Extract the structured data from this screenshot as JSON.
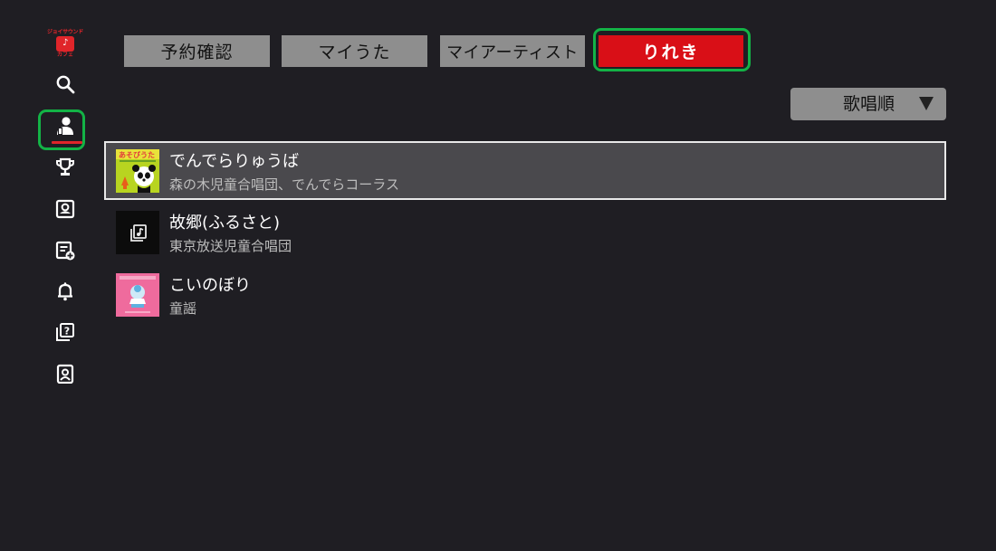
{
  "app": {
    "logo_top": "ジョイサウンド",
    "logo_mark": "♪",
    "logo_bottom": "カフェ"
  },
  "sidebar": {
    "items": [
      {
        "name": "search-icon",
        "active": false
      },
      {
        "name": "user-icon",
        "active": true
      },
      {
        "name": "trophy-icon",
        "active": false
      },
      {
        "name": "download-icon",
        "active": false
      },
      {
        "name": "playlist-add-icon",
        "active": false
      },
      {
        "name": "bell-icon",
        "active": false
      },
      {
        "name": "help-icon",
        "active": false
      },
      {
        "name": "profile-card-icon",
        "active": false
      }
    ]
  },
  "tabs": [
    {
      "label": "予約確認",
      "active": false
    },
    {
      "label": "マイうた",
      "active": false
    },
    {
      "label": "マイアーティスト",
      "active": false
    },
    {
      "label": "りれき",
      "active": true
    }
  ],
  "sort": {
    "label": "歌唱順",
    "icon": "triangle-down-icon"
  },
  "songs": [
    {
      "title": "でんでらりゅうば",
      "artist": "森の木児童合唱団、でんでらコーラス",
      "selected": true,
      "thumb": "album-art-panda"
    },
    {
      "title": "故郷(ふるさと)",
      "artist": "東京放送児童合唱団",
      "selected": false,
      "thumb": "music-note-icon"
    },
    {
      "title": "こいのぼり",
      "artist": "童謡",
      "selected": false,
      "thumb": "album-art-pink"
    }
  ],
  "colors": {
    "background": "#1f1e23",
    "accent_red": "#d90f17",
    "focus_green": "#13b346",
    "tab_gray": "#8e8e8e"
  }
}
